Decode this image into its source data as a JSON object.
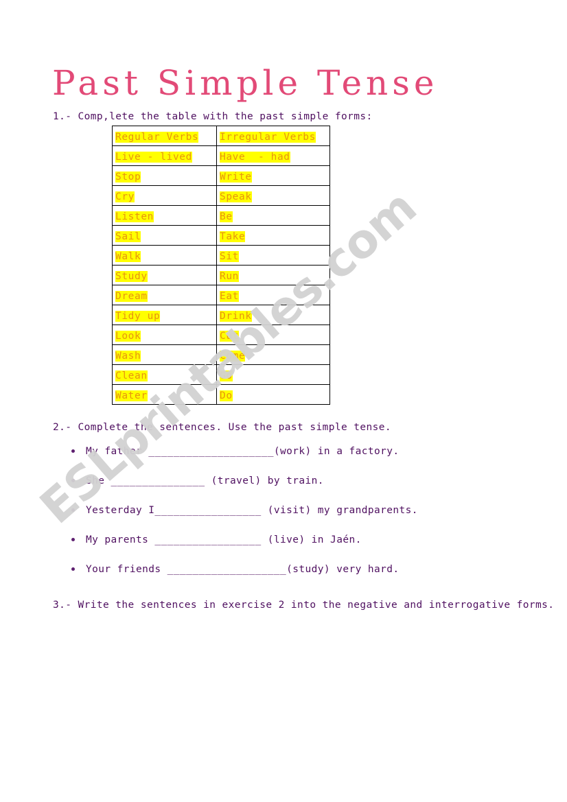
{
  "page": {
    "title": "Past Simple Tense",
    "title_color": "#e24a77",
    "body_text_color": "#4f1060",
    "table_text_color": "#e8940f",
    "highlight_color": "#ffff00",
    "background_color": "#ffffff"
  },
  "watermark": {
    "text": "ESLprintables.com",
    "color": "#d2d2d2"
  },
  "exercise1": {
    "instruction": "1.- Comp,lete the table with the past simple forms:",
    "table": {
      "headers": [
        "Regular Verbs",
        "Irregular Verbs"
      ],
      "rows": [
        [
          "Live - lived",
          "Have  - had"
        ],
        [
          "Stop",
          "Write"
        ],
        [
          "Cry",
          "Speak"
        ],
        [
          "Listen",
          "Be"
        ],
        [
          "Sail",
          "Take"
        ],
        [
          "Walk",
          "Sit"
        ],
        [
          "Study",
          "Run"
        ],
        [
          "Dream",
          "Eat"
        ],
        [
          "Tidy up",
          "Drink"
        ],
        [
          "Look",
          "Cut"
        ],
        [
          "Wash",
          "Come"
        ],
        [
          "Clean",
          "Go"
        ],
        [
          "Water",
          "Do"
        ]
      ]
    }
  },
  "exercise2": {
    "instruction": "2.- Complete the sentences. Use the past simple tense.",
    "items": [
      "My father ____________________(work) in a factory.",
      "She _______________ (travel) by train.",
      "Yesterday I_________________ (visit) my grandparents.",
      "My parents _________________ (live) in Jaén.",
      "Your friends ___________________(study) very hard."
    ]
  },
  "exercise3": {
    "instruction": "3.- Write the sentences in exercise 2 into the negative and interrogative forms."
  }
}
